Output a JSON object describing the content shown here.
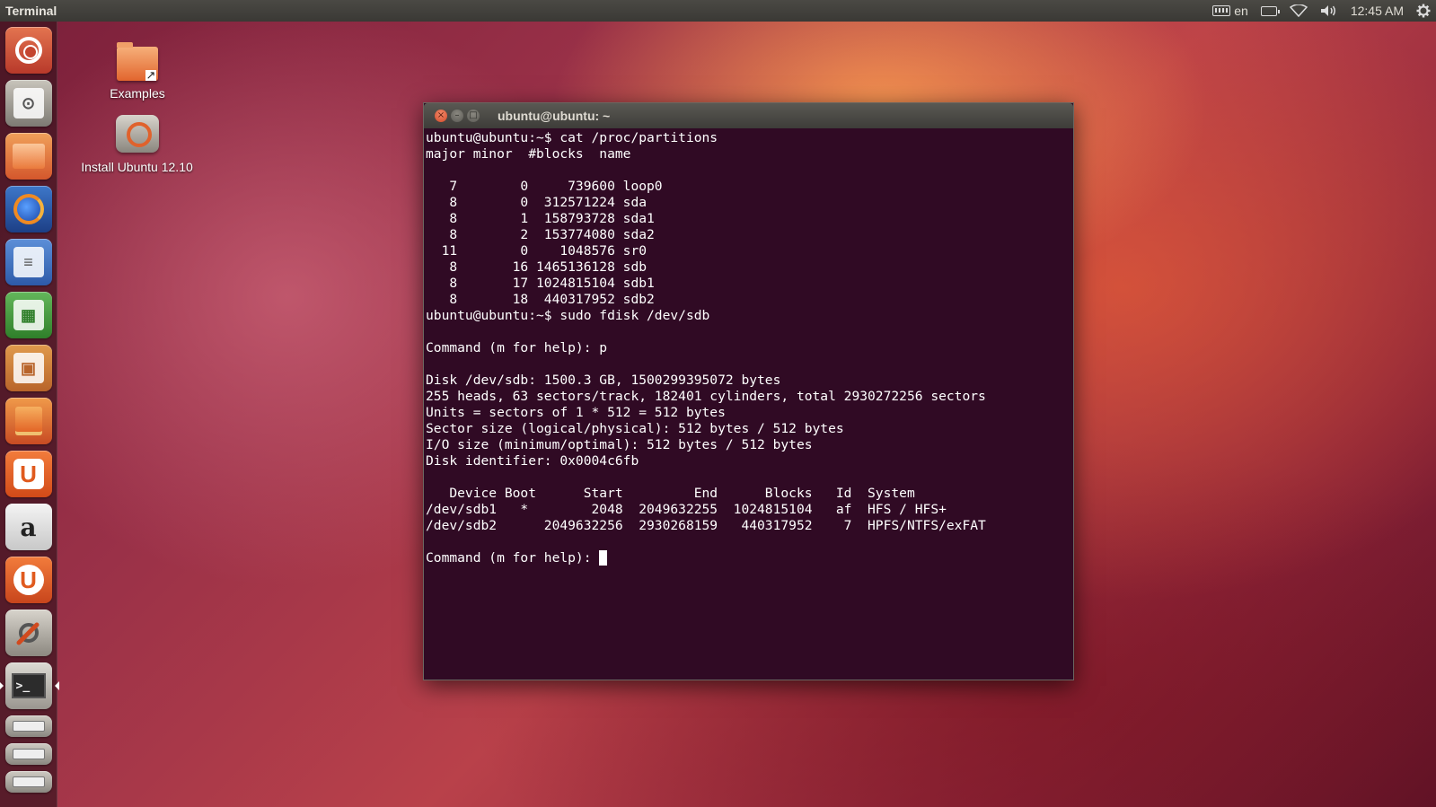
{
  "top_panel": {
    "app_name": "Terminal",
    "language": "en",
    "clock": "12:45 AM",
    "icons": [
      "keyboard-icon",
      "battery-icon",
      "wifi-icon",
      "volume-icon",
      "gear-icon"
    ]
  },
  "launcher": {
    "items": [
      {
        "name": "dash",
        "icon": "ubuntu-logo-icon"
      },
      {
        "name": "install-ubuntu",
        "icon": "installer-icon"
      },
      {
        "name": "files",
        "icon": "folder-icon"
      },
      {
        "name": "firefox",
        "icon": "firefox-icon"
      },
      {
        "name": "libreoffice-writer",
        "icon": "writer-icon"
      },
      {
        "name": "libreoffice-calc",
        "icon": "calc-icon"
      },
      {
        "name": "libreoffice-impress",
        "icon": "impress-icon"
      },
      {
        "name": "software-center",
        "icon": "shopping-bag-icon"
      },
      {
        "name": "ubuntu-one",
        "icon": "ubuntu-one-icon",
        "glyph": "U"
      },
      {
        "name": "amazon",
        "icon": "amazon-icon",
        "glyph": "a"
      },
      {
        "name": "ubuntu-one-music",
        "icon": "music-icon",
        "glyph": "U"
      },
      {
        "name": "system-settings",
        "icon": "settings-icon"
      },
      {
        "name": "terminal",
        "icon": "terminal-icon",
        "glyph": ">_",
        "active": true
      },
      {
        "name": "drive",
        "icon": "drive-icon"
      }
    ]
  },
  "desktop": {
    "icons": [
      {
        "label": "Examples",
        "icon": "folder-link-icon"
      },
      {
        "label": "Install Ubuntu 12.10",
        "icon": "installer-icon"
      }
    ]
  },
  "terminal": {
    "title": "ubuntu@ubuntu: ~",
    "buttons": {
      "close": "×",
      "minimize": "–",
      "maximize": "□"
    },
    "lines": [
      "ubuntu@ubuntu:~$ cat /proc/partitions",
      "major minor  #blocks  name",
      "",
      "   7        0     739600 loop0",
      "   8        0  312571224 sda",
      "   8        1  158793728 sda1",
      "   8        2  153774080 sda2",
      "  11        0    1048576 sr0",
      "   8       16 1465136128 sdb",
      "   8       17 1024815104 sdb1",
      "   8       18  440317952 sdb2",
      "ubuntu@ubuntu:~$ sudo fdisk /dev/sdb",
      "",
      "Command (m for help): p",
      "",
      "Disk /dev/sdb: 1500.3 GB, 1500299395072 bytes",
      "255 heads, 63 sectors/track, 182401 cylinders, total 2930272256 sectors",
      "Units = sectors of 1 * 512 = 512 bytes",
      "Sector size (logical/physical): 512 bytes / 512 bytes",
      "I/O size (minimum/optimal): 512 bytes / 512 bytes",
      "Disk identifier: 0x0004c6fb",
      "",
      "   Device Boot      Start         End      Blocks   Id  System",
      "/dev/sdb1   *        2048  2049632255  1024815104   af  HFS / HFS+",
      "/dev/sdb2      2049632256  2930268159   440317952    7  HPFS/NTFS/exFAT",
      ""
    ],
    "prompt": "Command (m for help): "
  }
}
